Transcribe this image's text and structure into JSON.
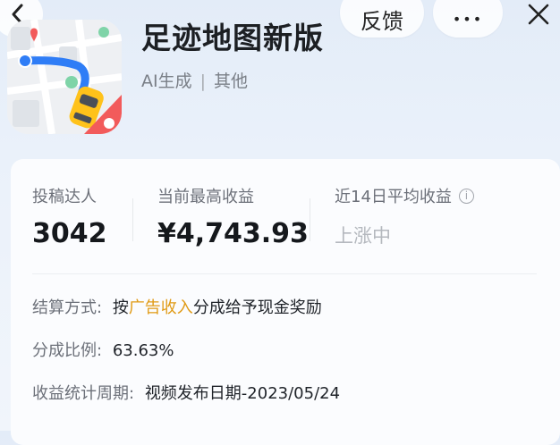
{
  "nav": {
    "feedback_label": "反馈",
    "more_label": "•••"
  },
  "app": {
    "title": "足迹地图新版",
    "tag": "AI生成",
    "separator": "|",
    "category": "其他",
    "icon": "map-route-car-icon"
  },
  "stats": [
    {
      "label": "投稿达人",
      "value": "3042"
    },
    {
      "label": "当前最高收益",
      "value": "¥4,743.93"
    },
    {
      "label": "近14日平均收益",
      "value": "上涨中"
    }
  ],
  "details": {
    "settlement_label": "结算方式:",
    "settlement_prefix": "按",
    "settlement_highlight": "广告收入",
    "settlement_suffix": "分成给予现金奖励",
    "ratio_label": "分成比例:",
    "ratio_value": "63.63%",
    "period_label": "收益统计周期:",
    "period_value": "视频发布日期-2023/05/24"
  },
  "colors": {
    "highlight": "#e09a14",
    "background": "#e3ecf8",
    "card": "#fbfcfe"
  }
}
